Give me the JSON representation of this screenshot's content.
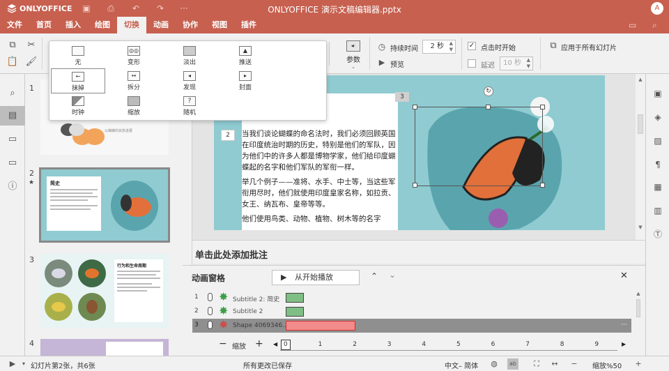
{
  "titlebar": {
    "app_name": "ONLYOFFICE",
    "doc_title": "ONLYOFFICE 演示文稿编辑器.pptx",
    "avatar_letter": "A",
    "icons": [
      "save-icon",
      "print-icon",
      "undo-icon",
      "redo-icon",
      "more-icon"
    ]
  },
  "menu": {
    "tabs": [
      "文件",
      "首页",
      "插入",
      "绘图",
      "切换",
      "动画",
      "协作",
      "视图",
      "插件"
    ],
    "active_tab": "切换"
  },
  "ribbon": {
    "params_label": "参数",
    "duration_label": "持续时间",
    "duration_value": "2 秒",
    "preview_label": "预览",
    "on_click_label": "点击时开始",
    "delay_label": "延迟",
    "delay_value": "10 秒",
    "apply_all_label": "应用于所有幻灯片"
  },
  "transitions": [
    {
      "label": "无"
    },
    {
      "label": "变形"
    },
    {
      "label": "淡出"
    },
    {
      "label": "推送"
    },
    {
      "label": "抹掉"
    },
    {
      "label": "拆分"
    },
    {
      "label": "发现"
    },
    {
      "label": "封面"
    },
    {
      "label": "时钟"
    },
    {
      "label": "缩放"
    },
    {
      "label": "随机"
    }
  ],
  "selected_transition": "抹掉",
  "thumbnails": {
    "numbers": [
      "1",
      "2",
      "3",
      "4"
    ],
    "slide1_caption": "以蝴蝶的状态进展",
    "slide2_title": "简史",
    "slide3_title": "行为和生命周期"
  },
  "slide": {
    "number_badge_a": "3",
    "number_badge_b": "2",
    "paragraphs": [
      "当我们谈论蝴蝶的命名法时，我们必须回顾英国在印度统治时期的历史，特别是他们的军队，因为他们中的许多人都是博物学家，他们给印度蝴蝶起的名字和他们军队的军衔一样。",
      "举几个例子——准将、水手、中士等，当这些军衔用尽时，他们就使用印度皇家名称，如拉贡、女王、纳瓦布、皇帝等等。",
      "他们使用鸟类、动物、植物、树木等的名字"
    ]
  },
  "notes": {
    "placeholder": "单击此处添加批注"
  },
  "animation_pane": {
    "title": "动画窗格",
    "play_label": "从开始播放",
    "rows": [
      {
        "num": "1",
        "label": "Subtitle 2: 简史",
        "color": "#7fbf86"
      },
      {
        "num": "2",
        "label": "Subtitle 2",
        "color": "#7fbf86"
      },
      {
        "num": "3",
        "label": "Shape 4069346...",
        "color": "#f28b8b"
      }
    ],
    "zoom_label": "缩放",
    "timeline_ticks": [
      "0",
      "1",
      "2",
      "3",
      "4",
      "5",
      "6",
      "7",
      "8",
      "9"
    ],
    "row_more": "···"
  },
  "status": {
    "slide_info": "幻灯片第2张，共6张",
    "save_status": "所有更改已保存",
    "language": "中文– 简体",
    "zoom": "缩放%50"
  },
  "colors": {
    "accent": "#c7604f",
    "slide_bg": "#8fcbd1",
    "anim_green": "#7fbf86",
    "anim_red": "#f28b8b"
  }
}
